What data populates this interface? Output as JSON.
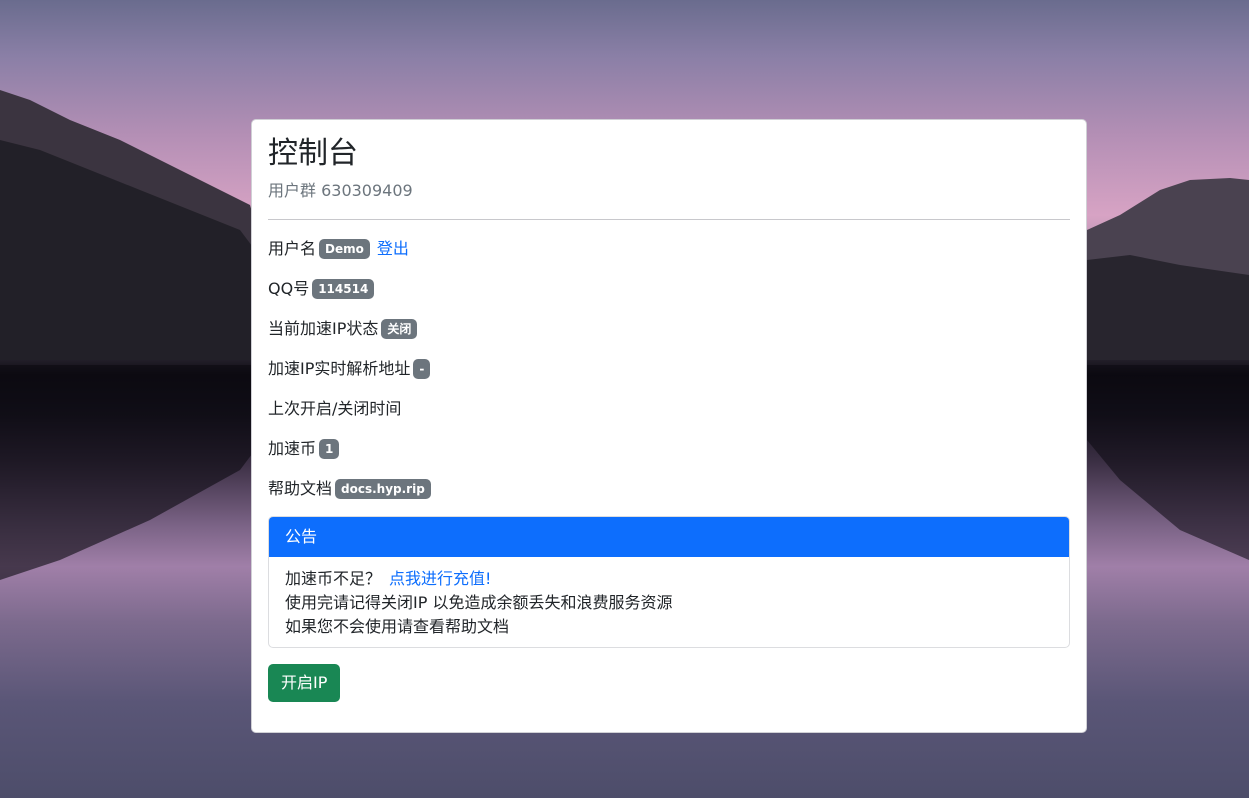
{
  "page": {
    "title": "控制台",
    "subtitle": "用户群 630309409"
  },
  "fields": {
    "username_label": "用户名",
    "username_value": "Demo",
    "logout_label": "登出",
    "qq_label": "QQ号",
    "qq_value": "114514",
    "ip_status_label": "当前加速IP状态",
    "ip_status_value": "关闭",
    "resolve_label": "加速IP实时解析地址",
    "resolve_value": "-",
    "last_toggle_label": "上次开启/关闭时间",
    "coins_label": "加速币",
    "coins_value": "1",
    "docs_label": "帮助文档",
    "docs_value": "docs.hyp.rip"
  },
  "notice": {
    "header": "公告",
    "line1_text": "加速币不足？",
    "line1_link": "点我进行充值!",
    "line2": "使用完请记得关闭IP 以免造成余额丢失和浪费服务资源",
    "line3": "如果您不会使用请查看帮助文档"
  },
  "actions": {
    "start_ip_label": "开启IP"
  },
  "colors": {
    "primary": "#0d6efd",
    "success": "#198754",
    "badge": "#6c757d"
  }
}
